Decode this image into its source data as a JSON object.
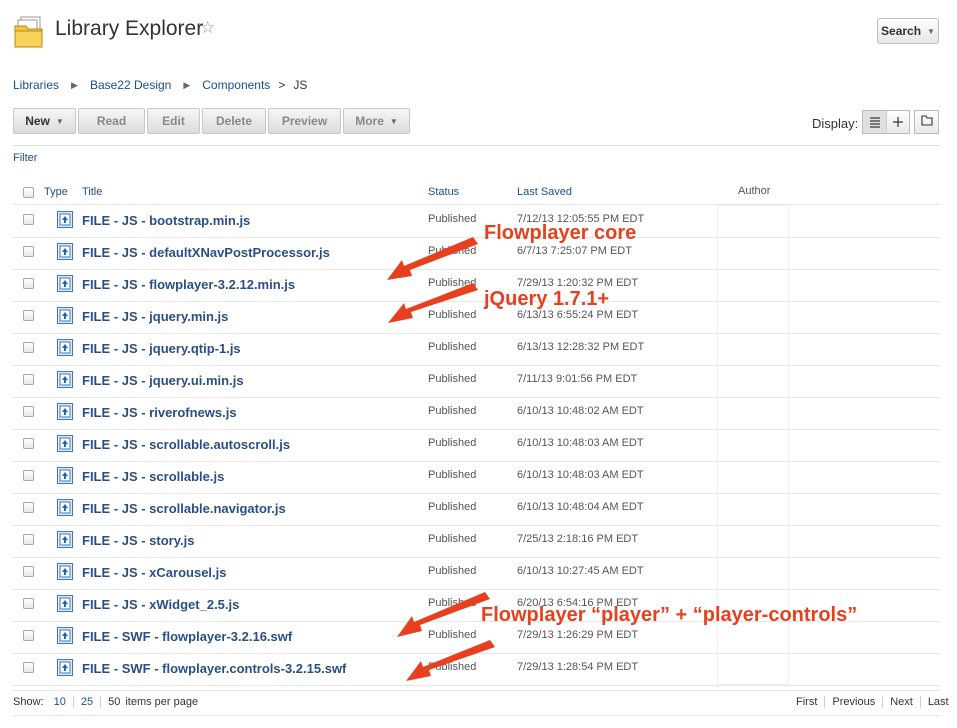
{
  "header": {
    "title": "Library Explorer",
    "search_label": "Search"
  },
  "breadcrumb": [
    "Libraries",
    "Base22 Design",
    "Components",
    "JS"
  ],
  "toolbar": {
    "buttons": [
      "New",
      "Read",
      "Edit",
      "Delete",
      "Preview",
      "More"
    ],
    "display_label": "Display:"
  },
  "filter_label": "Filter",
  "table": {
    "columns": [
      "Type",
      "Title",
      "Status",
      "Last Saved",
      "Author"
    ],
    "rows": [
      {
        "title": "FILE - JS - bootstrap.min.js",
        "status": "Published",
        "saved": "7/12/13 12:05:55 PM EDT"
      },
      {
        "title": "FILE - JS - defaultXNavPostProcessor.js",
        "status": "Published",
        "saved": "6/7/13 7:25:07 PM EDT"
      },
      {
        "title": "FILE - JS - flowplayer-3.2.12.min.js",
        "status": "Published",
        "saved": "7/29/13 1:20:32 PM EDT"
      },
      {
        "title": "FILE - JS - jquery.min.js",
        "status": "Published",
        "saved": "6/13/13 6:55:24 PM EDT"
      },
      {
        "title": "FILE - JS - jquery.qtip-1.js",
        "status": "Published",
        "saved": "6/13/13 12:28:32 PM EDT"
      },
      {
        "title": "FILE - JS - jquery.ui.min.js",
        "status": "Published",
        "saved": "7/11/13 9:01:56 PM EDT"
      },
      {
        "title": "FILE - JS - riverofnews.js",
        "status": "Published",
        "saved": "6/10/13 10:48:02 AM EDT"
      },
      {
        "title": "FILE - JS - scrollable.autoscroll.js",
        "status": "Published",
        "saved": "6/10/13 10:48:03 AM EDT"
      },
      {
        "title": "FILE - JS - scrollable.js",
        "status": "Published",
        "saved": "6/10/13 10:48:03 AM EDT"
      },
      {
        "title": "FILE - JS - scrollable.navigator.js",
        "status": "Published",
        "saved": "6/10/13 10:48:04 AM EDT"
      },
      {
        "title": "FILE - JS - story.js",
        "status": "Published",
        "saved": "7/25/13 2:18:16 PM EDT"
      },
      {
        "title": "FILE - JS - xCarousel.js",
        "status": "Published",
        "saved": "6/10/13 10:27:45 AM EDT"
      },
      {
        "title": "FILE - JS - xWidget_2.5.js",
        "status": "Published",
        "saved": "6/20/13 6:54:16 PM EDT"
      },
      {
        "title": "FILE - SWF - flowplayer-3.2.16.swf",
        "status": "Published",
        "saved": "7/29/13 1:26:29 PM EDT"
      },
      {
        "title": "FILE - SWF - flowplayer.controls-3.2.15.swf",
        "status": "Published",
        "saved": "7/29/13 1:28:54 PM EDT"
      }
    ]
  },
  "annotations": {
    "flowplayer_core": "Flowplayer core",
    "jquery": "jQuery 1.7.1+",
    "flowplayer_player": "Flowplayer “player” + “player-controls”",
    "color": "#e8401e"
  },
  "footer": {
    "show_label": "Show:",
    "per_page_options": [
      "10",
      "25",
      "50"
    ],
    "per_page_suffix": "items per page",
    "pager": [
      "First",
      "Previous",
      "Next",
      "Last"
    ]
  }
}
